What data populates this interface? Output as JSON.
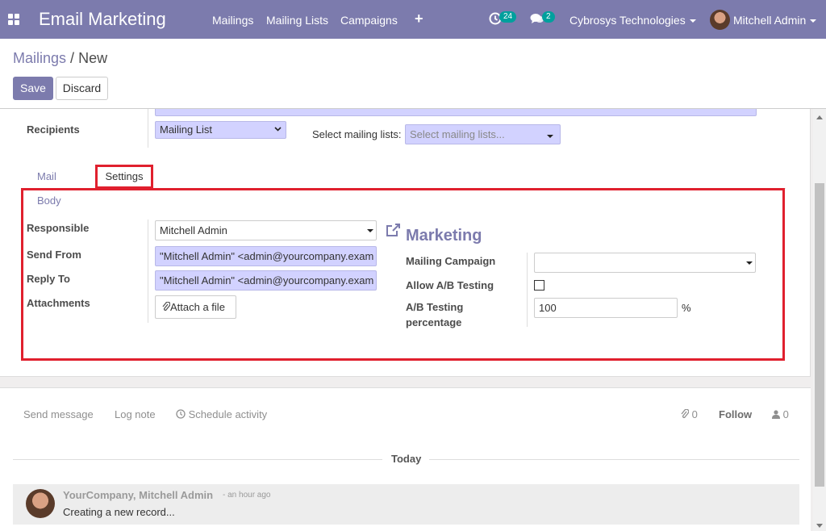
{
  "navbar": {
    "brand": "Email Marketing",
    "menu": [
      "Mailings",
      "Mailing Lists",
      "Campaigns"
    ],
    "plus_icon": "+",
    "activity_count": "24",
    "messages_count": "2",
    "company": "Cybrosys Technologies",
    "user": "Mitchell Admin"
  },
  "breadcrumb": {
    "parent": "Mailings",
    "separator": "/",
    "current": "New"
  },
  "buttons": {
    "save": "Save",
    "discard": "Discard"
  },
  "form": {
    "recipients_label": "Recipients",
    "recipients_value": "Mailing List",
    "mailing_lists_label": "Select mailing lists:",
    "mailing_lists_placeholder": "Select mailing lists...",
    "tabs": {
      "mail_body": "Mail Body",
      "settings": "Settings"
    },
    "responsible_label": "Responsible",
    "responsible_value": "Mitchell Admin",
    "send_from_label": "Send From",
    "send_from_value": "\"Mitchell Admin\" <admin@yourcompany.exam",
    "reply_to_label": "Reply To",
    "reply_to_value": "\"Mitchell Admin\" <admin@yourcompany.exam",
    "attachments_label": "Attachments",
    "attach_button": "Attach a file",
    "marketing_title": "Marketing",
    "campaign_label": "Mailing Campaign",
    "campaign_value": "",
    "ab_testing_label": "Allow A/B Testing",
    "ab_testing_checked": false,
    "ab_percentage_label_1": "A/B Testing",
    "ab_percentage_label_2": "percentage",
    "ab_percentage_value": "100",
    "ab_percentage_unit": "%"
  },
  "chatter": {
    "send_message": "Send message",
    "log_note": "Log note",
    "schedule_activity": "Schedule activity",
    "attachments_count": "0",
    "follow": "Follow",
    "followers_count": "0",
    "today": "Today",
    "message": {
      "author": "YourCompany, Mitchell Admin",
      "time": "- an hour ago",
      "text": "Creating a new record..."
    }
  },
  "colors": {
    "brand": "#7c7bad",
    "highlight": "#e0202e",
    "field_required": "#d2d2ff",
    "badge": "#00a09d"
  },
  "icons": [
    "apps-grid-icon",
    "plus-icon",
    "activity-clock-icon",
    "chat-bubbles-icon",
    "external-link-icon",
    "paperclip-icon",
    "clock-icon",
    "user-icon"
  ]
}
